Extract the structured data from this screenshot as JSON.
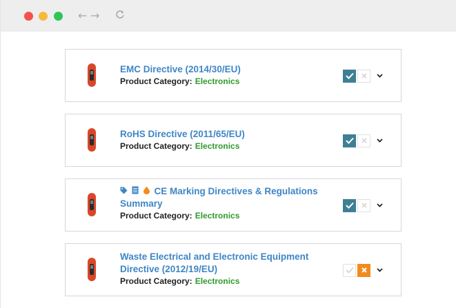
{
  "browser": {
    "controls": {
      "back": "←",
      "forward": "→",
      "reload": "C"
    }
  },
  "category_label": "Product Category:",
  "items": [
    {
      "title": "EMC Directive (2014/30/EU)",
      "category": "Electronics",
      "check_active": true,
      "x_active": false
    },
    {
      "title": "RoHS Directive (2011/65/EU)",
      "category": "Electronics",
      "check_active": true,
      "x_active": false
    },
    {
      "title": "CE Marking Directives & Regulations Summary",
      "category": "Electronics",
      "check_active": true,
      "x_active": false,
      "icons": [
        "tag-icon",
        "document-icon",
        "drop-icon"
      ]
    },
    {
      "title": "Waste Electrical and Electronic Equipment Directive (2012/19/EU)",
      "category": "Electronics",
      "check_active": false,
      "x_active": true
    }
  ],
  "colors": {
    "title_link": "#3d86c6",
    "category": "#2f9a2f",
    "check_active": "#3f7f96",
    "x_active": "#f28b1d",
    "thumb": "#d9472b"
  }
}
